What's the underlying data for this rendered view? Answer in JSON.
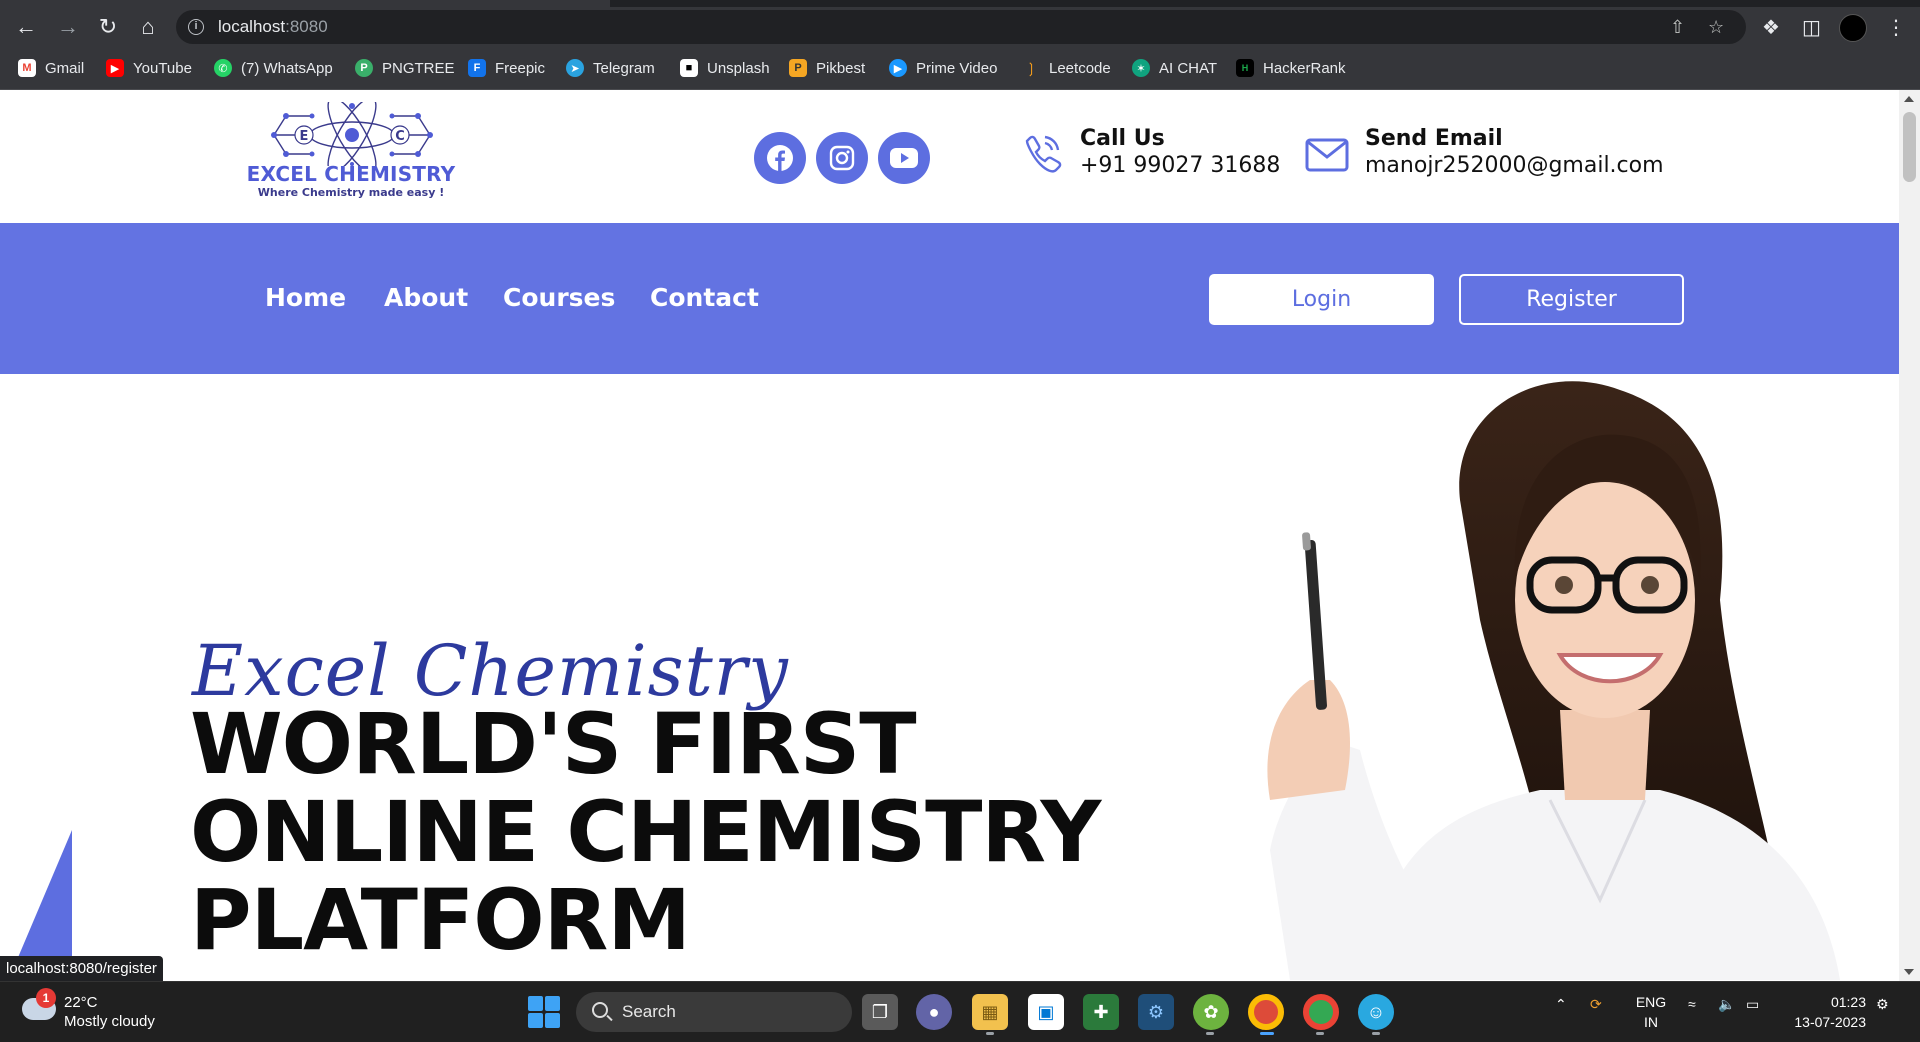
{
  "browser": {
    "url_host": "localhost",
    "url_port": ":8080",
    "bookmarks": [
      {
        "label": "Gmail",
        "icon": "gmail-icon",
        "color": "#ea4335"
      },
      {
        "label": "YouTube",
        "icon": "youtube-icon",
        "color": "#ff0000"
      },
      {
        "label": "(7) WhatsApp",
        "icon": "whatsapp-icon",
        "color": "#25d366"
      },
      {
        "label": "PNGTREE",
        "icon": "pngtree-icon",
        "color": "#3aaf6a"
      },
      {
        "label": "Freepic",
        "icon": "freepik-icon",
        "color": "#1273eb"
      },
      {
        "label": "Telegram",
        "icon": "telegram-icon",
        "color": "#2aa3e0"
      },
      {
        "label": "Unsplash",
        "icon": "unsplash-icon",
        "color": "#ffffff"
      },
      {
        "label": "Pikbest",
        "icon": "pikbest-icon",
        "color": "#f5a623"
      },
      {
        "label": "Prime Video",
        "icon": "prime-video-icon",
        "color": "#1a98ff"
      },
      {
        "label": "Leetcode",
        "icon": "leetcode-icon",
        "color": "#f89f1b"
      },
      {
        "label": "AI CHAT",
        "icon": "ai-chat-icon",
        "color": "#10a37f"
      },
      {
        "label": "HackerRank",
        "icon": "hackerrank-icon",
        "color": "#1ba94c"
      }
    ],
    "status_url": "localhost:8080/register"
  },
  "site": {
    "brand": "EXCEL CHEMISTRY",
    "tagline": "Where Chemistry made easy !",
    "logo_letters": [
      "E",
      "C",
      "C"
    ],
    "social": [
      {
        "icon": "facebook-icon"
      },
      {
        "icon": "instagram-icon"
      },
      {
        "icon": "youtube-icon"
      }
    ],
    "call": {
      "heading": "Call Us",
      "value": "+91 99027 31688"
    },
    "email": {
      "heading": "Send Email",
      "value": "manojr252000@gmail.com"
    },
    "nav": [
      "Home",
      "About",
      "Courses",
      "Contact"
    ],
    "login_label": "Login",
    "register_label": "Register",
    "accent_color": "#6373e2",
    "hero": {
      "script_title": "Excel Chemistry",
      "line1": "WORLD'S FIRST",
      "line2": "ONLINE CHEMISTRY",
      "line3": "PLATFORM"
    }
  },
  "taskbar": {
    "weather_badge": "1",
    "temperature": "22°C",
    "condition": "Mostly cloudy",
    "search_label": "Search",
    "lang_top": "ENG",
    "lang_bottom": "IN",
    "time": "01:23",
    "date": "13-07-2023"
  }
}
